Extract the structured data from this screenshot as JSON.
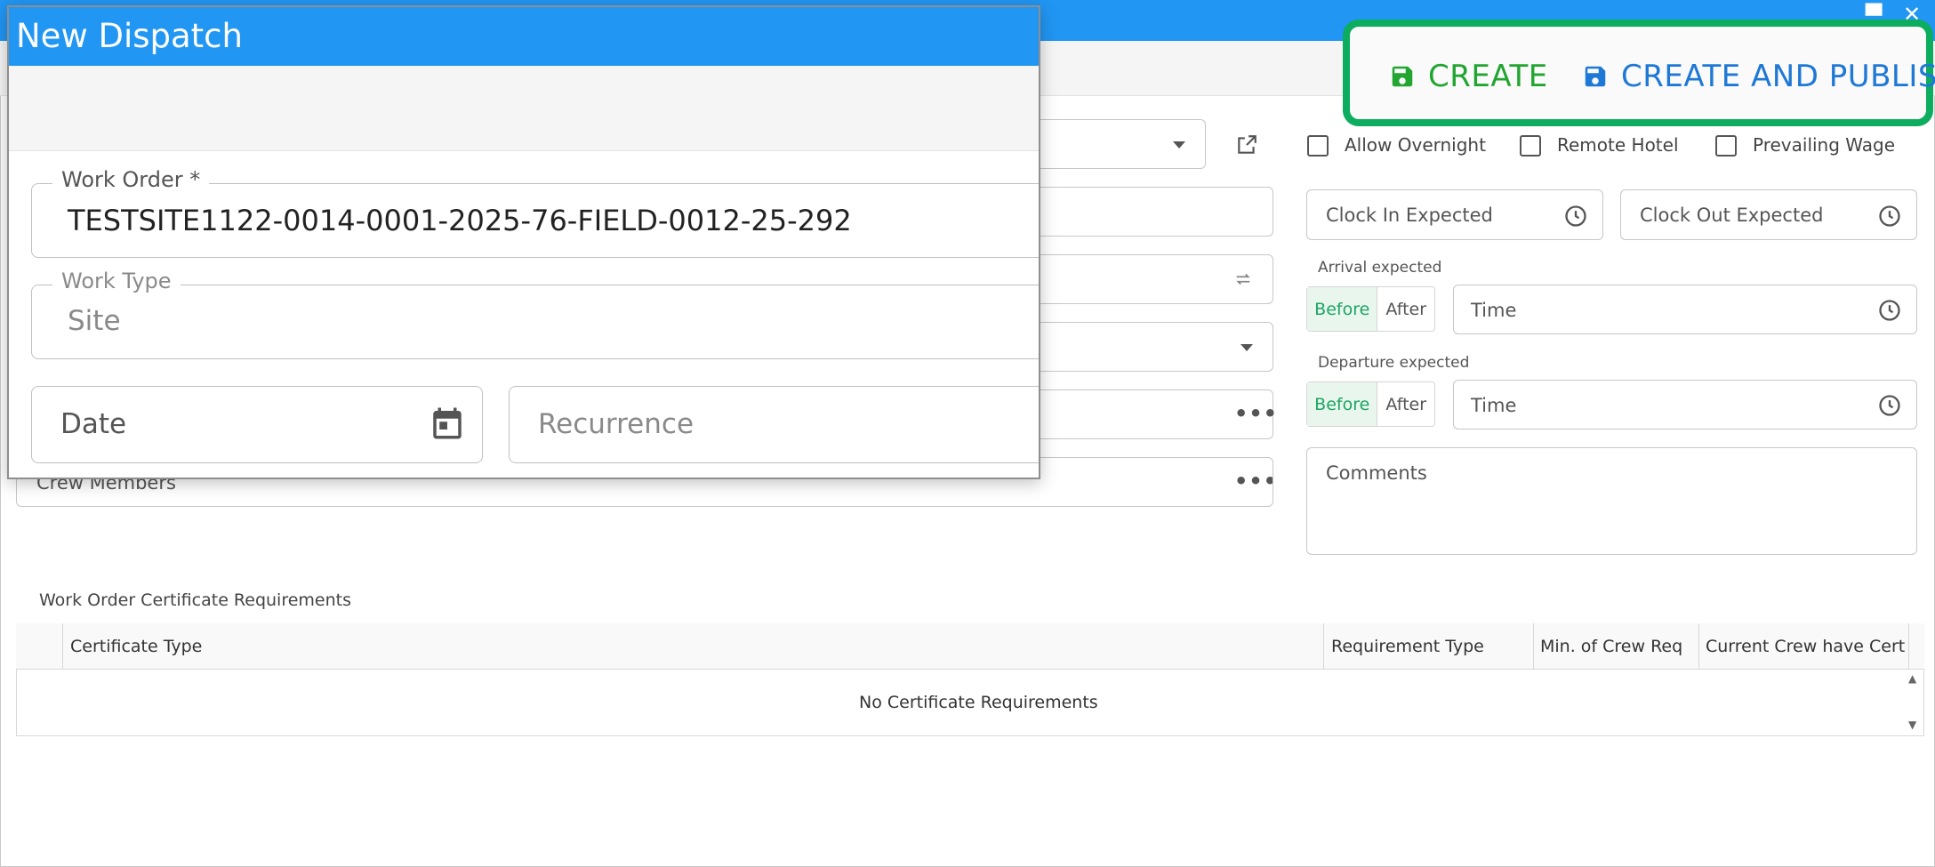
{
  "window": {
    "maximize_glyph": "▀",
    "close_glyph": "✕"
  },
  "actions": {
    "create_label": "CREATE",
    "publish_label": "CREATE AND PUBLISH",
    "icon": "save-icon",
    "create_color": "#22a531",
    "publish_color": "#1e78d6",
    "highlight_color": "#0cad5e"
  },
  "checkboxes": [
    {
      "label": "Allow Overnight",
      "checked": false
    },
    {
      "label": "Remote Hotel",
      "checked": false
    },
    {
      "label": "Prevailing Wage",
      "checked": false
    }
  ],
  "clock": {
    "in_placeholder": "Clock In Expected",
    "out_placeholder": "Clock Out Expected"
  },
  "arrival": {
    "label": "Arrival expected",
    "before": "Before",
    "after": "After",
    "selected": "Before",
    "time_placeholder": "Time"
  },
  "departure": {
    "label": "Departure expected",
    "before": "Before",
    "after": "After",
    "selected": "Before",
    "time_placeholder": "Time"
  },
  "comments": {
    "placeholder": "Comments"
  },
  "crew": {
    "label": "Crew Members"
  },
  "certificates": {
    "section_title": "Work Order Certificate Requirements",
    "columns": [
      "Certificate Type",
      "Requirement Type",
      "Min. of Crew Req",
      "Current Crew have Cert"
    ],
    "empty_message": "No Certificate Requirements"
  },
  "modal": {
    "title": "New Dispatch",
    "work_order": {
      "label": "Work Order *",
      "value": "TESTSITE1122-0014-0001-2025-76-FIELD-0012-25-292"
    },
    "work_type": {
      "label": "Work Type",
      "value": "Site"
    },
    "date": {
      "placeholder": "Date"
    },
    "recurrence": {
      "placeholder": "Recurrence"
    }
  },
  "colors": {
    "title_bar": "#2196f3",
    "toggle_active": "#1fa463"
  }
}
